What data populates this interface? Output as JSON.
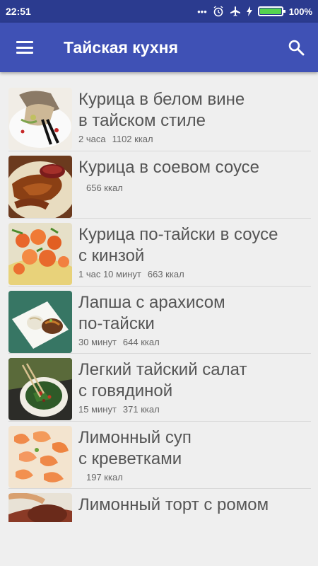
{
  "status": {
    "time": "22:51",
    "battery": "100%"
  },
  "appbar": {
    "title": "Тайская кухня"
  },
  "recipes": [
    {
      "name_line1": "Курица в белом вине",
      "name_line2": "в тайском стиле",
      "time": "2 часа",
      "kcal": "1102 ккал"
    },
    {
      "name_line1": "Курица в соевом соусе",
      "name_line2": "",
      "time": "",
      "kcal": "656 ккал"
    },
    {
      "name_line1": "Курица по-тайски в соусе",
      "name_line2": "с кинзой",
      "time": "1 час 10 минут",
      "kcal": "663 ккал"
    },
    {
      "name_line1": "Лапша с арахисом",
      "name_line2": "по-тайски",
      "time": "30 минут",
      "kcal": "644 ккал"
    },
    {
      "name_line1": "Легкий тайский салат",
      "name_line2": "с говядиной",
      "time": "15 минут",
      "kcal": "371 ккал"
    },
    {
      "name_line1": "Лимонный суп",
      "name_line2": "с креветками",
      "time": "",
      "kcal": "197 ккал"
    },
    {
      "name_line1": "Лимонный торт с ромом",
      "name_line2": "",
      "time": "",
      "kcal": ""
    }
  ],
  "colors": {
    "statusbar": "#2b3b8f",
    "appbar": "#3f51b5",
    "background": "#efefef",
    "text": "#555555"
  }
}
